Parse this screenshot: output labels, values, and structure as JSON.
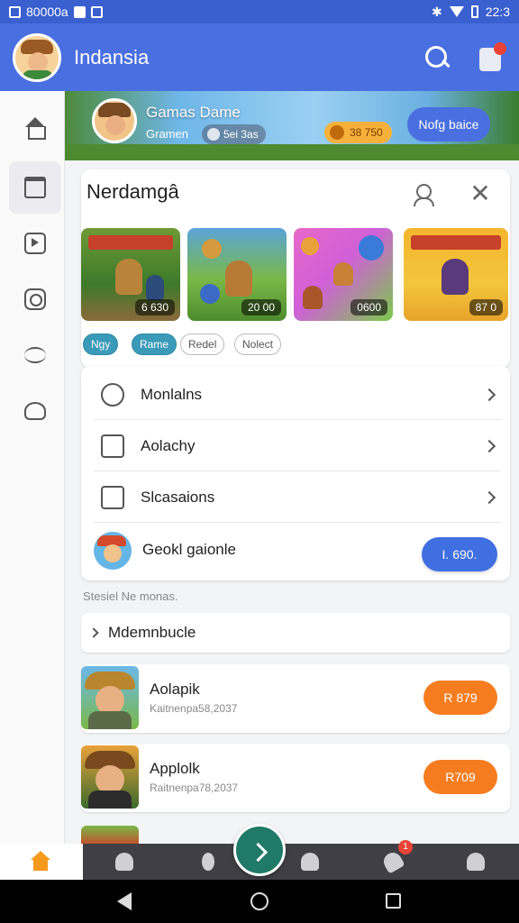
{
  "status_bar": {
    "left_text": "80000a",
    "time": "22:3"
  },
  "appbar": {
    "title": "Indansia"
  },
  "banner": {
    "title": "Gamas Dame",
    "subtitle": "Gramen",
    "pill": "5ei 3as",
    "coins": "38 750",
    "button_label": "Nofg baice"
  },
  "section": {
    "title": "Nerdamgâ",
    "thumbs": [
      {
        "tag": "6 630"
      },
      {
        "tag": "20 00"
      },
      {
        "tag": "0600"
      },
      {
        "tag": "87 0"
      }
    ],
    "chips": [
      {
        "label": "Ngy",
        "active": true
      },
      {
        "label": "Rame",
        "active": true
      },
      {
        "label": "Redel",
        "active": false
      },
      {
        "label": "Nolect",
        "active": false
      }
    ]
  },
  "menu": {
    "items": [
      {
        "label": "Monlalns"
      },
      {
        "label": "Aolachy"
      },
      {
        "label": "Slcasaions"
      }
    ],
    "footer_label": "Geokl gaionle",
    "footer_button": "I. 690."
  },
  "list": {
    "caption": "Stesiel Ne monas.",
    "expander_label": "Mdemnbucle",
    "games": [
      {
        "name": "Aolapik",
        "subtitle": "Kaitnenpa58,2037",
        "price": "R 879"
      },
      {
        "name": "Applolk",
        "subtitle": "Raitnenpa78,2037",
        "price": "R709"
      }
    ]
  },
  "bottom_nav": {
    "badge": "1"
  },
  "colors": {
    "appbar": "#4a6fe0",
    "accent_blue": "#3f6fe0",
    "accent_orange": "#f57d20",
    "chip_active": "#3a9ab8",
    "fab": "#1f7a67"
  }
}
